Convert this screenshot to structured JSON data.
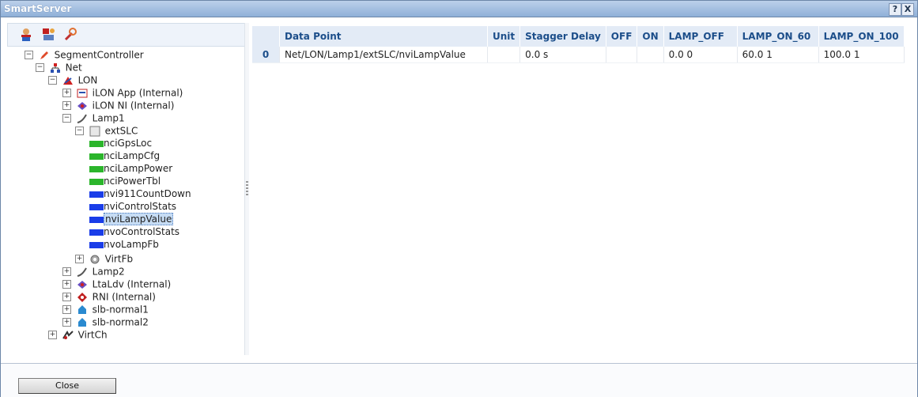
{
  "window": {
    "title": "SmartServer",
    "help_label": "?",
    "close_label": "X"
  },
  "toolbar": {
    "icons": [
      "user-icon",
      "network-icon",
      "wrench-icon"
    ]
  },
  "tree": {
    "segment_controller": "SegmentController",
    "net": "Net",
    "lon": "LON",
    "ilon_app": "iLON App (Internal)",
    "ilon_ni": "iLON NI (Internal)",
    "lamp1": "Lamp1",
    "extslc": "extSLC",
    "datapoints": [
      {
        "name": "nciGpsLoc",
        "kind": "cfg"
      },
      {
        "name": "nciLampCfg",
        "kind": "cfg"
      },
      {
        "name": "nciLampPower",
        "kind": "cfg"
      },
      {
        "name": "nciPowerTbl",
        "kind": "cfg"
      },
      {
        "name": "nvi911CountDown",
        "kind": "in"
      },
      {
        "name": "nviControlStats",
        "kind": "in"
      },
      {
        "name": "nviLampValue",
        "kind": "in"
      },
      {
        "name": "nvoControlStats",
        "kind": "out"
      },
      {
        "name": "nvoLampFb",
        "kind": "out"
      }
    ],
    "virtfb": "VirtFb",
    "lamp2": "Lamp2",
    "ltaldv": "LtaLdv (Internal)",
    "rni": "RNI (Internal)",
    "slb1": "slb-normal1",
    "slb2": "slb-normal2",
    "virtch": "VirtCh",
    "expand": "+",
    "collapse": "−"
  },
  "grid": {
    "columns": [
      "",
      "Data Point",
      "Unit",
      "Stagger Delay",
      "OFF",
      "ON",
      "LAMP_OFF",
      "LAMP_ON_60",
      "LAMP_ON_100"
    ],
    "rows": [
      [
        "0",
        "Net/LON/Lamp1/extSLC/nviLampValue",
        "",
        "0.0 s",
        "",
        "",
        "0.0 0",
        "60.0 1",
        "100.0 1"
      ]
    ]
  },
  "footer": {
    "close_button": "Close"
  }
}
